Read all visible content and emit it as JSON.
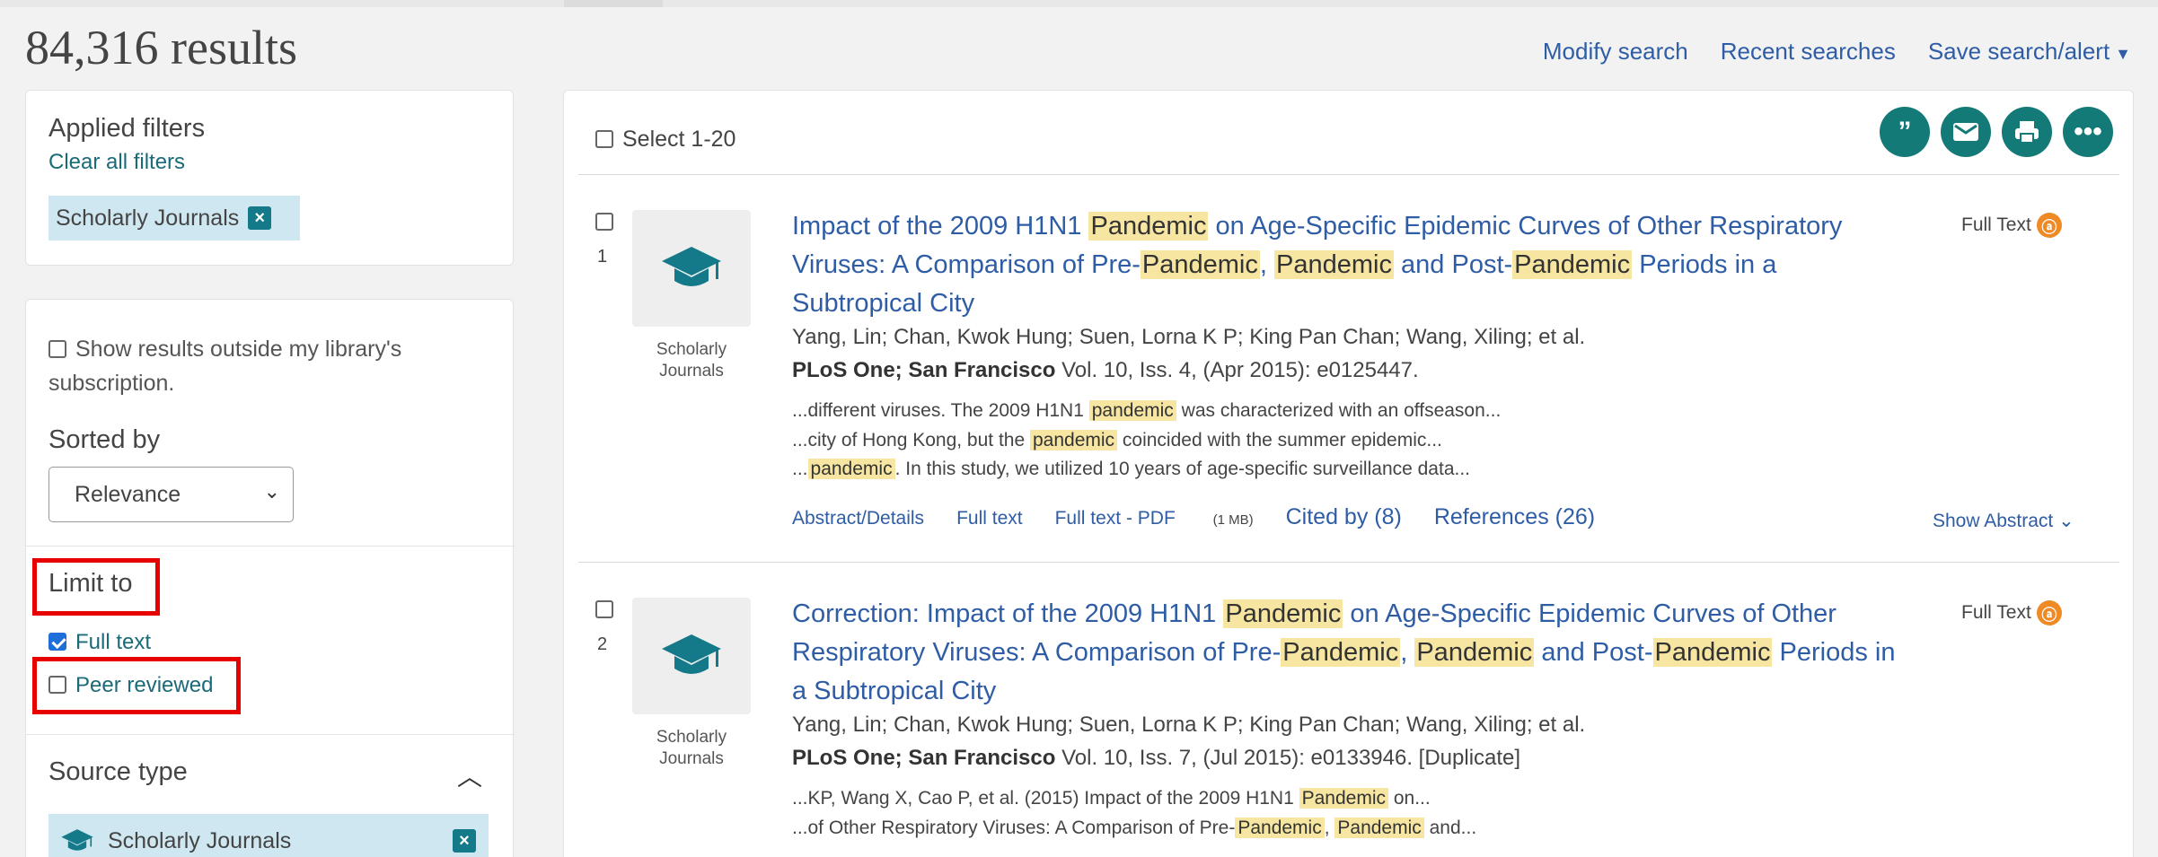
{
  "header": {
    "results_count": "84,316 results",
    "links": {
      "modify": "Modify search",
      "recent": "Recent searches",
      "save": "Save search/alert"
    }
  },
  "sidebar": {
    "applied_filters": {
      "title": "Applied filters",
      "clear_label": "Clear all filters",
      "chips": [
        "Scholarly Journals"
      ]
    },
    "show_outside": {
      "label": "Show results outside my library's subscription.",
      "checked": false
    },
    "sort": {
      "label": "Sorted by",
      "value": "Relevance"
    },
    "limit": {
      "title": "Limit to",
      "full_text": {
        "label": "Full text",
        "checked": true
      },
      "peer_reviewed": {
        "label": "Peer reviewed",
        "checked": false
      }
    },
    "source_type": {
      "title": "Source type",
      "selected": "Scholarly Journals"
    }
  },
  "results": {
    "select_label": "Select 1-20",
    "items": [
      {
        "number": "1",
        "type_label_1": "Scholarly",
        "type_label_2": "Journals",
        "authors": "Yang, Lin; Chan, Kwok Hung; Suen, Lorna K P; King Pan Chan; Wang, Xiling; et al.",
        "journal": "PLoS One; San Francisco",
        "citation": " Vol. 10, Iss. 4,  (Apr 2015): e0125447.",
        "full_text_label": "Full Text",
        "links": {
          "abstract": "Abstract/Details",
          "full_text": "Full text",
          "pdf": "Full text - PDF",
          "pdf_size": "(1 MB)",
          "cited_by": "Cited by (8)",
          "references": "References (26)"
        },
        "show_abstract": "Show Abstract"
      },
      {
        "number": "2",
        "type_label_1": "Scholarly",
        "type_label_2": "Journals",
        "authors": "Yang, Lin; Chan, Kwok Hung; Suen, Lorna K P; King Pan Chan; Wang, Xiling; et al.",
        "journal": "PLoS One; San Francisco",
        "citation": " Vol. 10, Iss. 7,  (Jul 2015): e0133946.  [Duplicate]",
        "full_text_label": "Full Text"
      }
    ],
    "title_parts": {
      "r1_a": "Impact of the 2009 H1N1 ",
      "r1_b": " on Age-Specific Epidemic Curves of Other Respiratory Viruses: A Comparison of Pre-",
      "r1_c": ", ",
      "r1_d": " and Post-",
      "r1_e": " Periods in a Subtropical City",
      "r2_a": "Correction: Impact of the 2009 H1N1 ",
      "r2_b": " on Age-Specific Epidemic Curves of Other Respiratory Viruses: A Comparison of Pre-",
      "r2_c": ", ",
      "r2_d": " and Post-",
      "r2_e": " Periods in a Subtropical City",
      "hl": "Pandemic"
    },
    "snippets": {
      "r1_s1_a": "...different viruses. The 2009 H1N1 ",
      "r1_s1_hl": "pandemic",
      "r1_s1_b": " was characterized with an offseason...",
      "r1_s2_a": "...city of Hong Kong, but the ",
      "r1_s2_hl": "pandemic",
      "r1_s2_b": " coincided with the summer epidemic...",
      "r1_s3_a": "...",
      "r1_s3_hl": "pandemic",
      "r1_s3_b": ". In this study, we utilized 10 years of age-specific surveillance data...",
      "r2_s1_a": "...KP, Wang X, Cao P, et al. (2015) Impact of the 2009 H1N1 ",
      "r2_s1_hl": "Pandemic",
      "r2_s1_b": " on...",
      "r2_s2_a": "...of Other Respiratory Viruses: A Comparison of Pre-",
      "r2_s2_hl": "Pandemic",
      "r2_s2_c": ", ",
      "r2_s2_hl2": "Pandemic",
      "r2_s2_b": " and..."
    }
  },
  "icons": {
    "cite": "quote-icon",
    "email": "email-icon",
    "print": "print-icon",
    "more": "more-icon",
    "accent": "#147a77",
    "link": "#2e5da6",
    "highlight": "#f7e6a2",
    "annotation": "#e60000"
  }
}
